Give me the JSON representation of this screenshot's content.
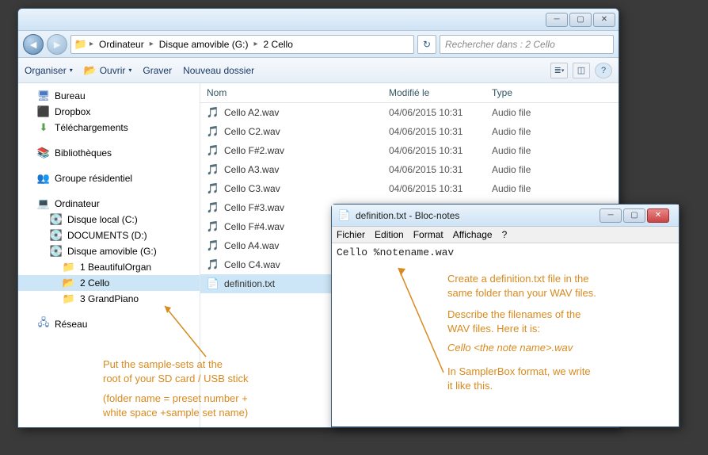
{
  "explorer": {
    "breadcrumb": [
      "Ordinateur",
      "Disque amovible (G:)",
      "2 Cello"
    ],
    "search_placeholder": "Rechercher dans : 2 Cello",
    "toolbar": {
      "organiser": "Organiser",
      "ouvrir": "Ouvrir",
      "graver": "Graver",
      "nouveau_dossier": "Nouveau dossier"
    },
    "nav": {
      "bureau": "Bureau",
      "dropbox": "Dropbox",
      "telechargements": "Téléchargements",
      "bibliotheques": "Bibliothèques",
      "groupe_residentiel": "Groupe résidentiel",
      "ordinateur": "Ordinateur",
      "disque_c": "Disque local (C:)",
      "documents_d": "DOCUMENTS (D:)",
      "disque_g": "Disque amovible (G:)",
      "folder1": "1 BeautifulOrgan",
      "folder2": "2 Cello",
      "folder3": "3 GrandPiano",
      "reseau": "Réseau"
    },
    "columns": {
      "nom": "Nom",
      "modifie": "Modifié le",
      "type": "Type"
    },
    "files": [
      {
        "name": "Cello A2.wav",
        "date": "04/06/2015 10:31",
        "type": "Audio file",
        "icon": "audio"
      },
      {
        "name": "Cello C2.wav",
        "date": "04/06/2015 10:31",
        "type": "Audio file",
        "icon": "audio"
      },
      {
        "name": "Cello F#2.wav",
        "date": "04/06/2015 10:31",
        "type": "Audio file",
        "icon": "audio"
      },
      {
        "name": "Cello A3.wav",
        "date": "04/06/2015 10:31",
        "type": "Audio file",
        "icon": "audio"
      },
      {
        "name": "Cello C3.wav",
        "date": "04/06/2015 10:31",
        "type": "Audio file",
        "icon": "audio"
      },
      {
        "name": "Cello F#3.wav",
        "date": "",
        "type": "",
        "icon": "audio"
      },
      {
        "name": "Cello F#4.wav",
        "date": "",
        "type": "",
        "icon": "audio"
      },
      {
        "name": "Cello A4.wav",
        "date": "",
        "type": "",
        "icon": "audio"
      },
      {
        "name": "Cello C4.wav",
        "date": "",
        "type": "",
        "icon": "audio"
      },
      {
        "name": "definition.txt",
        "date": "",
        "type": "",
        "icon": "text",
        "selected": true
      }
    ]
  },
  "notepad": {
    "title": "definition.txt - Bloc-notes",
    "menu": {
      "fichier": "Fichier",
      "edition": "Edition",
      "format": "Format",
      "affichage": "Affichage",
      "aide": "?"
    },
    "content": "Cello %notename.wav"
  },
  "annotations": {
    "left1": "Put the sample-sets at the\nroot of your SD card / USB stick",
    "left2": "(folder name = preset number +\nwhite space +sample set name)",
    "right1": "Create a definition.txt file in the\nsame folder than your WAV files.",
    "right2": "Describe the filenames of the\nWAV files. Here it is:",
    "right3": "Cello <the note name>.wav",
    "right4": "In SamplerBox format, we write\nit like this."
  }
}
